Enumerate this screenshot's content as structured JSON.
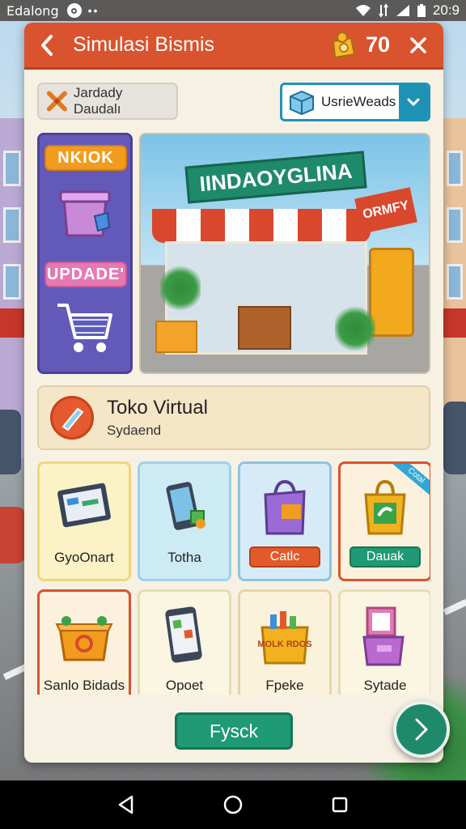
{
  "status_bar": {
    "carrier": "Edalong",
    "time": "20:9"
  },
  "header": {
    "title": "Simulasi Bismis",
    "coins": "70"
  },
  "toolbar": {
    "badge_label": "Jardady Daudalı",
    "dropdown_value": "UsrieWeads"
  },
  "side_panel": {
    "top_label": "NKIOK",
    "bottom_label": "UPDADE'"
  },
  "hero": {
    "main_sign": "IINDAOYGLINA",
    "side_sign": "ORMFY"
  },
  "info_card": {
    "name": "Toko Virtual",
    "subtitle": "Sydaend"
  },
  "tiles": [
    {
      "label": "GyoOnart"
    },
    {
      "label": "Totha"
    },
    {
      "label": "Catlc"
    },
    {
      "label": "Dauak",
      "ribbon": "Cotal"
    },
    {
      "label": "Sanlo Bidads"
    },
    {
      "label": "Opoet"
    },
    {
      "label": "Fpeke",
      "box_text": "MOLK RDOS"
    },
    {
      "label": "Sytade"
    }
  ],
  "footer": {
    "button_label": "Fysck"
  },
  "colors": {
    "header": "#d9532f",
    "accent_green": "#1f9a74",
    "accent_teal": "#1f93b6",
    "panel_bg": "#f7f1e4",
    "side_panel": "#6359b8"
  },
  "icons": {
    "back": "chevron-left-icon",
    "coin": "coin-bag-icon",
    "close": "close-icon",
    "dropdown": "chevron-down-icon",
    "next": "chevron-right-icon"
  }
}
